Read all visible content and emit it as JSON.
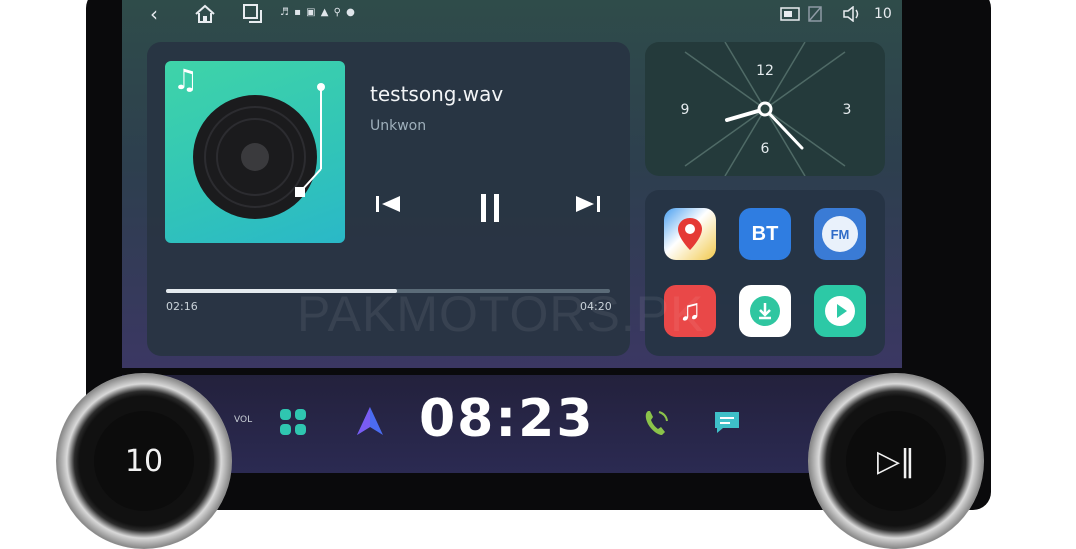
{
  "status_bar": {
    "notification_icons": "♬ ▪ ▣ ▲ ⚲ ●",
    "volume_level": "10"
  },
  "music_player": {
    "title": "testsong.wav",
    "artist": "Unkwon",
    "elapsed": "02:16",
    "duration": "04:20",
    "progress_fraction": 0.52
  },
  "analog_clock": {
    "numerals": [
      "12",
      "3",
      "6",
      "9"
    ]
  },
  "apps": [
    {
      "name": "maps-icon",
      "label": "",
      "color": "#f2c94c"
    },
    {
      "name": "bluetooth",
      "label": "BT",
      "color": "#2f7de1"
    },
    {
      "name": "fm-radio",
      "label": "FM",
      "color": "#3a7bd5"
    },
    {
      "name": "music-icon",
      "label": "",
      "color": "#e94848"
    },
    {
      "name": "download-icon",
      "label": "",
      "color": "#2fc6a0"
    },
    {
      "name": "video-play-icon",
      "label": "",
      "color": "#2cc9a6"
    }
  ],
  "dock": {
    "time": "08:23",
    "vol_label": "VOL"
  },
  "knobs": {
    "left_value": "10",
    "right_symbol": "▷‖"
  },
  "watermark": "PAKMOTORS.PK"
}
